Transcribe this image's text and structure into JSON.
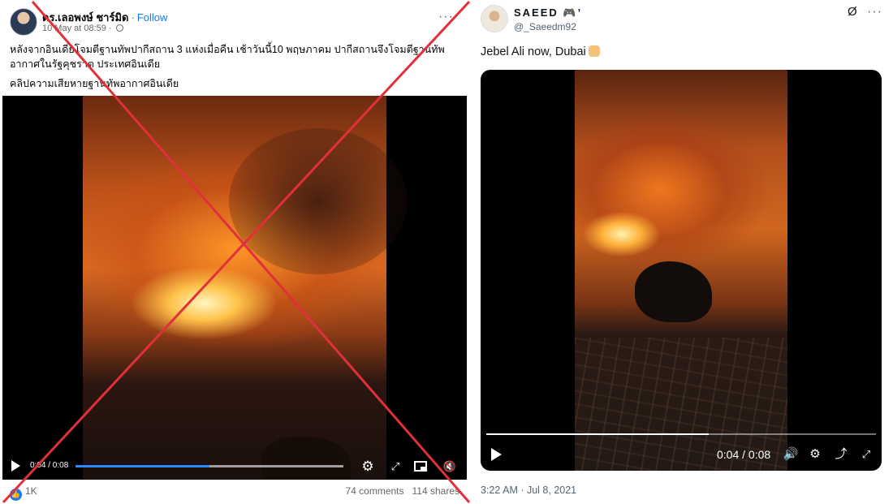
{
  "facebook_post": {
    "author_name": "ดร.เลอพงษ์ ชาร์มิด",
    "follow_label": "Follow",
    "timestamp": "10 May at 08:59 ·",
    "more_label": "···",
    "text_paragraph_1": "หลังจากอินเดียโจมตีฐานทัพปากีสถาน 3 แห่งเมื่อคืน เช้าวันนี้10 พฤษภาคม ปากีสถานจึงโจมตีฐานทัพอากาศในรัฐคุชราต ประเทศอินเดีย",
    "text_paragraph_2": "คลิปความเสียหายฐานทัพอากาศอินเดีย",
    "video": {
      "time_display": "0:04 / 0:08",
      "progress_fraction": 0.5,
      "accent_color": "#2d88ff"
    },
    "reaction_count": "1K",
    "comments": "74 comments",
    "shares": "114 shares",
    "crossed_out_color": "#e0303a"
  },
  "x_post": {
    "display_name": "SAEED",
    "display_name_emoji": "🎮’",
    "handle": "@_Saeedm92",
    "more_label": "···",
    "grok_icon": "Ø",
    "text": "Jebel Ali now, Dubai",
    "video": {
      "time_display": "0:04 / 0:08",
      "progress_fraction": 0.57
    },
    "timestamp": "3:22 AM · Jul 8, 2021"
  }
}
